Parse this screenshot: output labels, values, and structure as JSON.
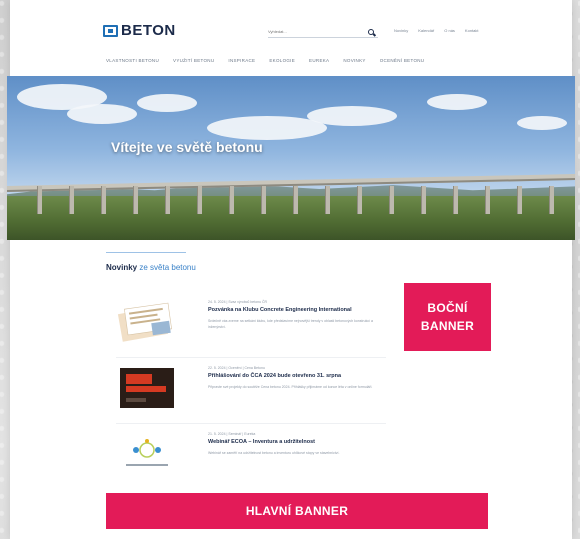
{
  "header": {
    "logo_text": "BETON",
    "search_placeholder": "Vyhledat...",
    "top_links": [
      "Novinky",
      "Kalendář",
      "O nás",
      "Kontakt"
    ],
    "main_nav": [
      "Vlastnosti betonu",
      "Využití betonu",
      "Inspirace",
      "Ekologie",
      "Eureka",
      "Novinky",
      "Ocenění betonu"
    ]
  },
  "hero": {
    "title": "Vítejte ve světě betonu"
  },
  "news_section": {
    "title_bold": "Novinky",
    "title_rest": " ze světa betonu",
    "items": [
      {
        "meta": "24. 5. 2024 | Svaz výrobců betonu ČR",
        "title": "Pozvánka na Klubu Concrete Engineering International",
        "text": "Srdečně vás zveme na setkání klubu, kde představíme nejnovější trendy v oblasti betonových konstrukcí a inženýrství."
      },
      {
        "meta": "22. 5. 2024 | Ocenění | Cena Betonu",
        "thumb_label_1": "CENA",
        "thumb_label_2": "BETONU",
        "title": "Přihlášování do ČCA 2024 bude otevřeno 31. srpna",
        "text": "Připravte své projekty do soutěže Cena betonu 2024. Přihlášky přijímáme od konce léta v online formuláři."
      },
      {
        "meta": "21. 5. 2024 | Seminář | Eureka",
        "title": "Webinář ECOA – Inventura a udržitelnost",
        "text": "Webinář se zaměří na udržitelnost betonu a inventuru uhlíkové stopy ve stavebnictví."
      }
    ]
  },
  "side_banner": {
    "line1": "BOČNÍ",
    "line2": "BANNER"
  },
  "main_banner": {
    "label": "HLAVNÍ BANNER"
  },
  "colors": {
    "accent": "#e31b58",
    "brand_blue": "#1f6fb5",
    "navy": "#1c2b4a"
  }
}
